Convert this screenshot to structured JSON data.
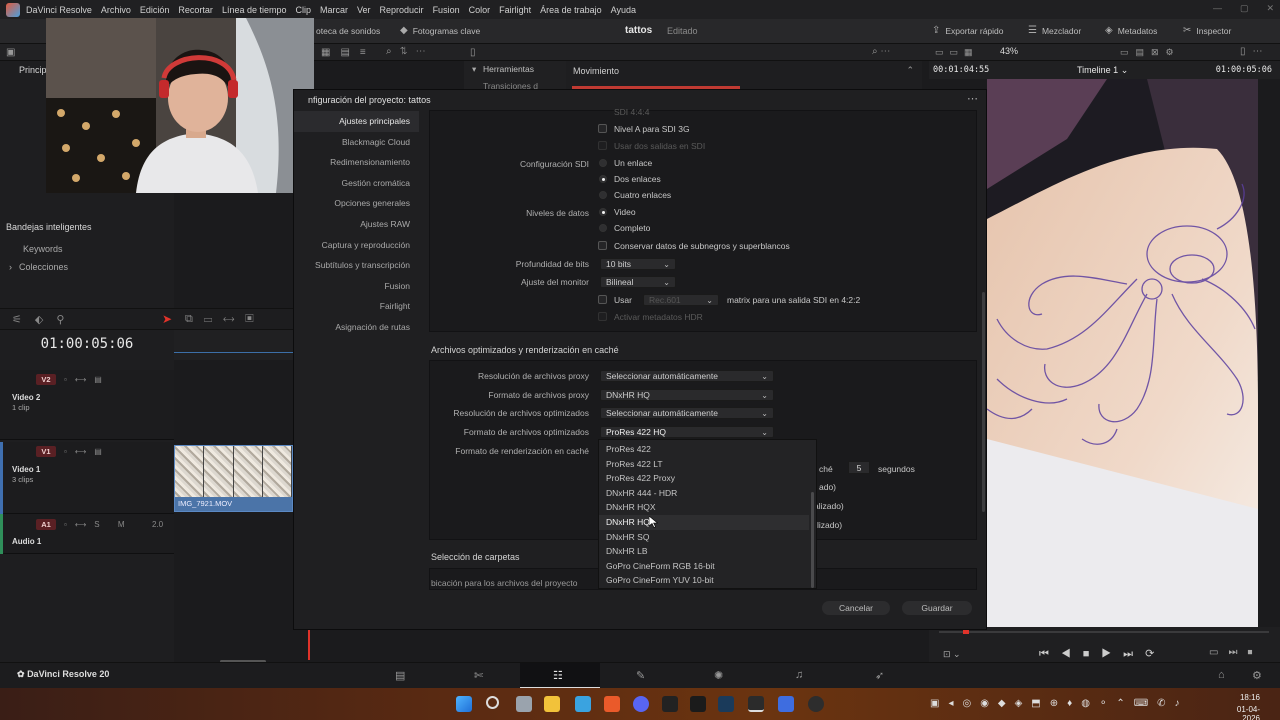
{
  "app": {
    "name": "DaVinci Resolve",
    "footer_name": "DaVinci Resolve 20"
  },
  "menu": [
    "DaVinci Resolve",
    "Archivo",
    "Edición",
    "Recortar",
    "Línea de tiempo",
    "Clip",
    "Marcar",
    "Ver",
    "Reproducir",
    "Fusion",
    "Color",
    "Fairlight",
    "Área de trabajo",
    "Ayuda"
  ],
  "toolbar": {
    "sound_library": "oteca de sonidos",
    "keyframes": "Fotogramas clave",
    "project_name": "tattos",
    "project_state": "Editado",
    "quick_export": "Exportar rápido",
    "mixer": "Mezclador",
    "metadata": "Metadatos",
    "inspector": "Inspector"
  },
  "bar2": {
    "zoom": "43%",
    "timecode_left": "00:01:04:55",
    "timeline_name": "Timeline 1",
    "timecode_right": "01:00:05:06",
    "tools_label": "Herramientas",
    "transitions_label": "Transiciones d",
    "movement_label": "Movimiento",
    "principal_tab": "Princip"
  },
  "sidebar": {
    "title": "Bandejas inteligentes",
    "items": [
      "Keywords",
      "Colecciones"
    ]
  },
  "timeline": {
    "timecode": "01:00:05:06",
    "tracks": [
      {
        "badge": "V2",
        "name": "Video 2",
        "sub": "1 clip"
      },
      {
        "badge": "V1",
        "name": "Video 1",
        "sub": "3 clips"
      },
      {
        "badge": "A1",
        "name": "Audio 1",
        "sub": "",
        "level": "2.0"
      }
    ],
    "clip_name": "IMG_7921.MOV"
  },
  "modal": {
    "title": "nfiguración del proyecto:  tattos",
    "nav": [
      "Ajustes principales",
      "Blackmagic Cloud",
      "Redimensionamiento",
      "Gestión cromática",
      "Opciones generales",
      "Ajustes RAW",
      "Captura y reproducción",
      "Subtítulos y transcripción",
      "Fusion",
      "Fairlight",
      "Asignación de rutas"
    ],
    "active_nav": 0,
    "sdi": {
      "cut_top": "SDI 4:4:4",
      "level_a": "Nivel A para SDI 3G",
      "dual_outputs": "Usar dos salidas en SDI",
      "config_label": "Configuración SDI",
      "config_options": [
        "Un enlace",
        "Dos enlaces",
        "Cuatro enlaces"
      ],
      "config_selected": 1,
      "data_levels_label": "Niveles de datos",
      "data_levels": [
        "Video",
        "Completo"
      ],
      "data_levels_selected": 0,
      "preserve": "Conservar datos de subnegros y superblancos",
      "bit_depth_label": "Profundidad de bits",
      "bit_depth_value": "10 bits",
      "monitor_scale_label": "Ajuste del monitor",
      "monitor_scale_value": "Bilineal",
      "use_label": "Usar",
      "rec_value": "Rec.601",
      "matrix_text": "matrix para una salida SDI en 4:2:2",
      "hdr_meta": "Activar metadatos HDR"
    },
    "cache": {
      "section_title": "Archivos optimizados y renderización en caché",
      "rows": [
        {
          "label": "Resolución de archivos proxy",
          "value": "Seleccionar automáticamente"
        },
        {
          "label": "Formato de archivos proxy",
          "value": "DNxHR HQ"
        },
        {
          "label": "Resolución de archivos optimizados",
          "value": "Seleccionar automáticamente"
        },
        {
          "label": "Formato de archivos optimizados",
          "value": "ProRes 422 HQ"
        }
      ],
      "render_cache_label": "Formato de renderización en caché",
      "peek_cache": "ché",
      "peek_value": "5",
      "peek_unit": "segundos",
      "peek_ado": "ado)",
      "peek_lizado1": "alizado)",
      "peek_lizado2": "lizado)"
    },
    "folders": {
      "section_title": "Selección de carpetas",
      "cut_row": "bicación para los archivos del proyecto"
    },
    "dropdown_options": [
      "ProRes 422",
      "ProRes 422 LT",
      "ProRes 422 Proxy",
      "DNxHR 444 - HDR",
      "DNxHR HQX",
      "DNxHR HQ",
      "DNxHR SQ",
      "DNxHR LB",
      "GoPro CineForm RGB 16-bit",
      "GoPro CineForm YUV 10-bit"
    ],
    "dropdown_highlighted": 5,
    "cancel": "Cancelar",
    "save": "Guardar"
  },
  "taskbar": {
    "time": "18:16",
    "date": "01-04-2026"
  },
  "colors": {
    "accent_red": "#e0332a",
    "clip_blue": "#4b74a8",
    "modal_bg": "#1f1f21"
  }
}
